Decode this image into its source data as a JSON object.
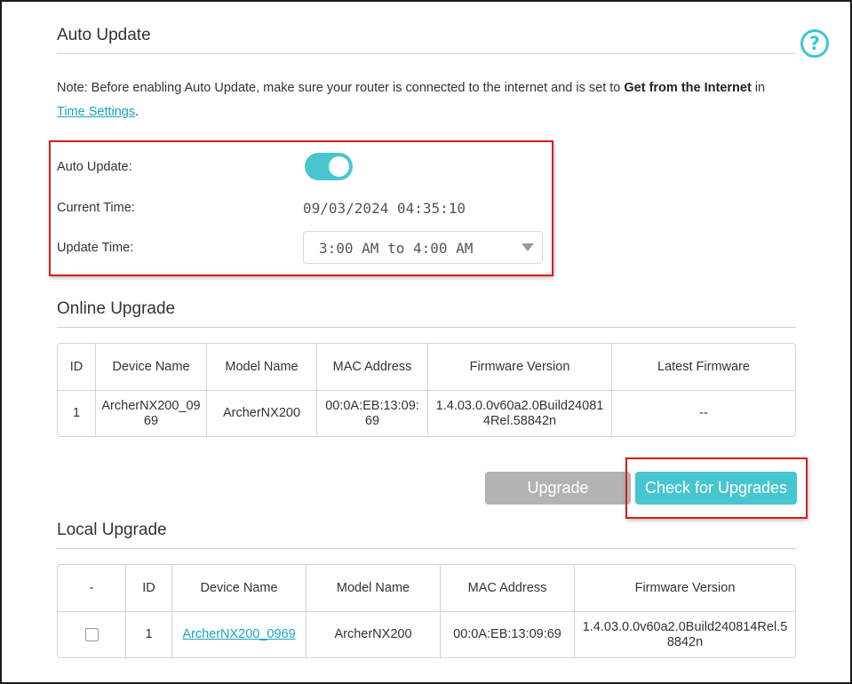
{
  "auto_update": {
    "title": "Auto Update",
    "note_prefix": "Note: Before enabling Auto Update, make sure your router is connected to the internet and is set to ",
    "note_bold": "Get from the Internet",
    "note_suffix": " in",
    "note_link": "Time Settings",
    "note_end": ".",
    "auto_update_label": "Auto Update:",
    "auto_update_enabled": true,
    "current_time_label": "Current Time:",
    "current_time_value": "09/03/2024 04:35:10",
    "update_time_label": "Update Time:",
    "update_time_value": "3:00 AM to 4:00 AM",
    "help_icon": "?"
  },
  "online_upgrade": {
    "title": "Online Upgrade",
    "columns": [
      "ID",
      "Device Name",
      "Model Name",
      "MAC Address",
      "Firmware Version",
      "Latest Firmware"
    ],
    "rows": [
      {
        "id": "1",
        "device_name": "ArcherNX200_09\n69",
        "model_name": "ArcherNX200",
        "mac_address": "00:0A:EB:13:09:\n69",
        "firmware_version": "1.4.03.0.0v60a2.0Build24081\n4Rel.58842n",
        "latest_firmware": "--"
      }
    ],
    "upgrade_button": "Upgrade",
    "check_button": "Check for Upgrades"
  },
  "local_upgrade": {
    "title": "Local Upgrade",
    "columns": [
      "-",
      "ID",
      "Device Name",
      "Model Name",
      "MAC Address",
      "Firmware Version"
    ],
    "rows": [
      {
        "checked": false,
        "id": "1",
        "device_name": "ArcherNX200_0969",
        "model_name": "ArcherNX200",
        "mac_address": "00:0A:EB:13:09:69",
        "firmware_version": "1.4.03.0.0v60a2.0Build240814Rel.5\n8842n"
      }
    ]
  },
  "colors": {
    "accent": "#47c6d0",
    "highlight_border": "#d81e1e",
    "disabled_button": "#b3b3b3",
    "link": "#1aa5c2"
  },
  "icons": {
    "help": "help-circle-icon",
    "dropdown": "caret-down-icon",
    "toggle": "toggle-switch-on"
  }
}
